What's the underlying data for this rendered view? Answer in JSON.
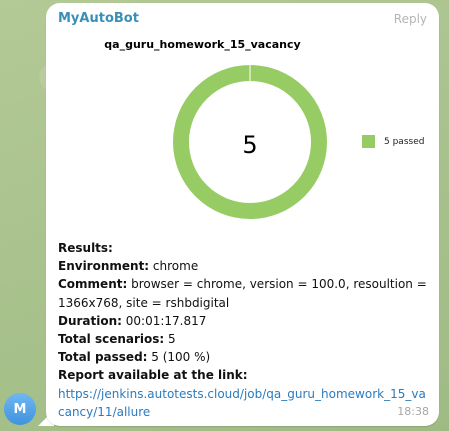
{
  "message": {
    "sender": "MyAutoBot",
    "reply_label": "Reply",
    "time": "18:38",
    "avatar_letter": "M"
  },
  "chart_data": {
    "type": "pie",
    "title": "qa_guru_homework_15_vacancy",
    "center_label": "5",
    "categories": [
      "passed"
    ],
    "values": [
      5
    ],
    "legend": [
      "5 passed"
    ],
    "colors": [
      "#97cc64"
    ],
    "legend_position": "right"
  },
  "report": {
    "results_label": "Results:",
    "environment_label": "Environment:",
    "environment_value": " chrome",
    "comment_label": "Comment:",
    "comment_value": " browser = chrome, version = 100.0, resoultion = 1366x768, site = rshbdigital",
    "duration_label": "Duration:",
    "duration_value": " 00:01:17.817",
    "total_scenarios_label": "Total scenarios:",
    "total_scenarios_value": " 5",
    "total_passed_label": "Total passed:",
    "total_passed_value": " 5 (100 %)",
    "link_label": "Report available at the link:",
    "link_url": "https://jenkins.autotests.cloud/job/qa_guru_homework_15_vacancy/11/allure"
  }
}
